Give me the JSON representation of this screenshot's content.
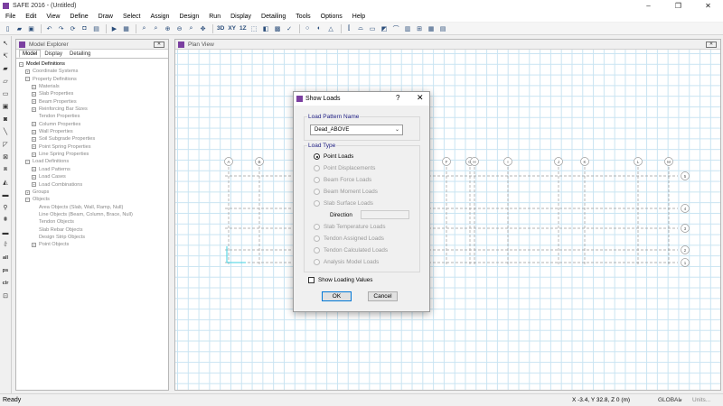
{
  "window": {
    "title": "SAFE 2016 - (Untitled)",
    "minimize": "–",
    "maximize": "❐",
    "close": "✕"
  },
  "menu": [
    "File",
    "Edit",
    "View",
    "Define",
    "Draw",
    "Select",
    "Assign",
    "Design",
    "Run",
    "Display",
    "Detailing",
    "Tools",
    "Options",
    "Help"
  ],
  "toolbar": {
    "view_3d": "3D",
    "view_xy": "XY",
    "view_1z": "1Z"
  },
  "left_tools": {
    "all": "all",
    "ps": "ps",
    "clr": "clr"
  },
  "explorer": {
    "title": "Model Explorer",
    "close": "✕",
    "tabs": [
      "Model",
      "Display",
      "Detailing"
    ],
    "tree": [
      {
        "label": "Model Definitions",
        "level": 0,
        "box": "−",
        "root": true
      },
      {
        "label": "Coordinate Systems",
        "level": 1,
        "box": "+"
      },
      {
        "label": "Property Definitions",
        "level": 1,
        "box": "−"
      },
      {
        "label": "Materials",
        "level": 2,
        "box": "+"
      },
      {
        "label": "Slab Properties",
        "level": 2,
        "box": "+"
      },
      {
        "label": "Beam Properties",
        "level": 2,
        "box": "+"
      },
      {
        "label": "Reinforcing Bar Sizes",
        "level": 2,
        "box": "+"
      },
      {
        "label": "Tendon Properties",
        "level": 2,
        "box": ""
      },
      {
        "label": "Column Properties",
        "level": 2,
        "box": "+"
      },
      {
        "label": "Wall Properties",
        "level": 2,
        "box": "+"
      },
      {
        "label": "Soil Subgrade Properties",
        "level": 2,
        "box": "+"
      },
      {
        "label": "Point Spring Properties",
        "level": 2,
        "box": "+"
      },
      {
        "label": "Line Spring Properties",
        "level": 2,
        "box": "+"
      },
      {
        "label": "Load Definitions",
        "level": 1,
        "box": "−"
      },
      {
        "label": "Load Patterns",
        "level": 2,
        "box": "+"
      },
      {
        "label": "Load Cases",
        "level": 2,
        "box": "+"
      },
      {
        "label": "Load Combinations",
        "level": 2,
        "box": "+"
      },
      {
        "label": "Groups",
        "level": 1,
        "box": "+"
      },
      {
        "label": "Objects",
        "level": 1,
        "box": "−"
      },
      {
        "label": "Area Objects (Slab, Wall, Ramp, Null)",
        "level": 2,
        "box": ""
      },
      {
        "label": "Line Objects (Beam, Column, Brace, Null)",
        "level": 2,
        "box": ""
      },
      {
        "label": "Tendon Objects",
        "level": 2,
        "box": ""
      },
      {
        "label": "Slab Rebar Objects",
        "level": 2,
        "box": ""
      },
      {
        "label": "Design Strip Objects",
        "level": 2,
        "box": ""
      },
      {
        "label": "Point Objects",
        "level": 2,
        "box": "+"
      }
    ]
  },
  "plan_view": {
    "title": "Plan View",
    "close": "✕"
  },
  "dialog": {
    "title": "Show Loads",
    "help": "?",
    "close": "✕",
    "load_pattern_label": "Load Pattern Name",
    "load_pattern_value": "Dead_ABOVE",
    "load_type_label": "Load Type",
    "options": [
      {
        "label": "Point Loads",
        "checked": true,
        "enabled": true
      },
      {
        "label": "Point Displacements",
        "checked": false,
        "enabled": false
      },
      {
        "label": "Beam Force Loads",
        "checked": false,
        "enabled": false
      },
      {
        "label": "Beam Moment Loads",
        "checked": false,
        "enabled": false
      },
      {
        "label": "Slab Surface Loads",
        "checked": false,
        "enabled": false
      },
      {
        "label": "Slab Temperature Loads",
        "checked": false,
        "enabled": false
      },
      {
        "label": "Tendon Assigned Loads",
        "checked": false,
        "enabled": false
      },
      {
        "label": "Tendon Calculated Loads",
        "checked": false,
        "enabled": false
      },
      {
        "label": "Analysis Model Loads",
        "checked": false,
        "enabled": false
      }
    ],
    "direction_label": "Direction",
    "show_values_label": "Show Loading Values",
    "ok": "OK",
    "cancel": "Cancel"
  },
  "grid_bubbles": {
    "columns": [
      "A",
      "B",
      "C",
      "D",
      "E",
      "F",
      "G",
      "H",
      "I",
      "J",
      "K",
      "L",
      "M",
      "N"
    ],
    "rows": [
      "5",
      "4",
      "3",
      "2",
      "1"
    ]
  },
  "status": {
    "left": "Ready",
    "coords": "X -3.4,  Y 32.8,  Z 0  (m)",
    "system": "GLOBAL",
    "units": "Units..."
  },
  "colors": {
    "grid": "#c9e4f2",
    "gridline": "#9a9a9a",
    "accent": "#7b3fa0",
    "group_label": "#1a1a80"
  }
}
